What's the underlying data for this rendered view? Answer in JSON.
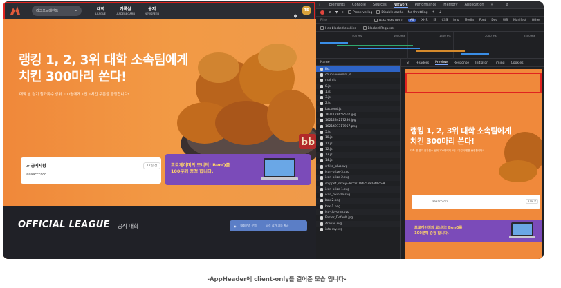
{
  "header": {
    "select_value": "리그오브레전드",
    "nav": [
      {
        "k": "대회",
        "e": "LEAGUE"
      },
      {
        "k": "기록실",
        "e": "LEADERBOARD"
      },
      {
        "k": "공지",
        "e": "NEWSFEED"
      }
    ],
    "avatar_initials": "TE"
  },
  "hero": {
    "title_line1": "랭킹 1, 2, 3위 대학 소속팀에게",
    "title_line2": "치킨 300마리 쏜다!",
    "subtitle": "대학 별 경기 참가횟수 상위 100명에게 1인 1치킨 쿠폰을 증정합니다!",
    "badge": "bb"
  },
  "notice": {
    "title": "공지사항",
    "date": "17일 전",
    "text": "aaaacccccc"
  },
  "promo": {
    "line1": "프로게이머의 모니터! BenQ를",
    "line2": "100분께 증정 합니다."
  },
  "league": {
    "title": "OFFICIAL LEAGUE",
    "subtitle": "공식 대회",
    "btn1": "대회운영 문의",
    "btn2": "공식 참가 기능 제공"
  },
  "devtools": {
    "tabs": [
      "Elements",
      "Console",
      "Sources",
      "Network",
      "Performance",
      "Memory",
      "Application",
      "»"
    ],
    "active_tab": "Network",
    "toolbar": {
      "preserve": "Preserve log",
      "disable": "Disable cache",
      "throttle": "No throttling"
    },
    "filter": {
      "label": "Filter",
      "hide": "Hide data URLs",
      "types": [
        "All",
        "XHR",
        "JS",
        "CSS",
        "Img",
        "Media",
        "Font",
        "Doc",
        "WS",
        "Manifest",
        "Other"
      ]
    },
    "filter2": {
      "blocked_cookies": "Has blocked cookies",
      "blocked_requests": "Blocked Requests"
    },
    "timeline_labels": [
      "500 ms",
      "1000 ms",
      "1500 ms",
      "2000 ms",
      "2500 ms"
    ],
    "list_header": "Name",
    "files": [
      "list",
      "chunk-vendors.js",
      "main.js",
      "8.js",
      "1.js",
      "3.js",
      "2.js",
      "backend.js",
      "1621178658507.jpg",
      "1621234217230.jpg",
      "1621497317957.png",
      "5.js",
      "10.js",
      "11.js",
      "12.js",
      "13.js",
      "14.js",
      "white_plus.svg",
      "icon-prize-3.svg",
      "icon-prize-2.svg",
      "snippet.js?key=8cc9019b-53a0-4476-8...",
      "icon-prize-1.svg",
      "icon_twinkle.svg",
      "box-2.png",
      "box-1.png",
      "ico-tlol-gray.svg",
      "Poster_Default.jpg",
      "Arenas.svg",
      "info-my.svg"
    ],
    "preview_tabs": [
      "×",
      "Headers",
      "Preview",
      "Response",
      "Initiator",
      "Timing",
      "Cookies"
    ],
    "active_preview_tab": "Preview",
    "preview": {
      "title_line1": "랭킹 1, 2, 3위 대학 소속팀에게",
      "title_line2": "치킨 300마리 쏜다!",
      "subtitle": "대학 별 경기 참가횟수 상위 100명에게 1인 1치킨 쿠폰을 증정합니다!",
      "notice_text": "aaaacccccc",
      "notice_date": "17일 전",
      "promo_line1": "프로게이머의 모니터! BenQ를",
      "promo_line2": "100분께 증정 합니다."
    }
  },
  "caption": "-AppHeader에 client-only를 걸어준 모습 입니다-",
  "colors": {
    "highlight": "#e0231f",
    "hero_orange": "#f08a3a",
    "promo_purple": "#7b4bb9"
  }
}
